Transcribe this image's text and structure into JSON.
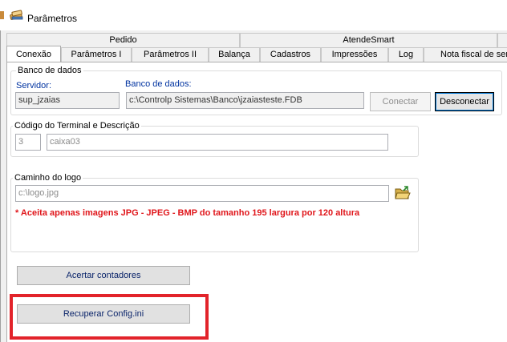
{
  "window": {
    "title": "Parâmetros"
  },
  "tabs_top": [
    {
      "label": "Pedido"
    },
    {
      "label": "AtendeSmart"
    }
  ],
  "tabs_bottom": [
    {
      "label": "Conexão",
      "active": true
    },
    {
      "label": "Parâmetros I"
    },
    {
      "label": "Parâmetros II"
    },
    {
      "label": "Balança"
    },
    {
      "label": "Cadastros"
    },
    {
      "label": "Impressões"
    },
    {
      "label": "Log"
    },
    {
      "label": "Nota fiscal de ser"
    }
  ],
  "database_group": {
    "title": "Banco de dados",
    "server_label": "Servidor:",
    "server_value": "sup_jzaias",
    "db_label": "Banco de dados:",
    "db_value": "c:\\Controlp Sistemas\\Banco\\jzaiasteste.FDB",
    "connect_button": "Conectar",
    "disconnect_button": "Desconectar"
  },
  "terminal_group": {
    "title": "Código do Terminal e Descrição",
    "code_value": "3",
    "description_value": "caixa03"
  },
  "logo_group": {
    "title": "Caminho do logo",
    "path_value": "c:\\logo.jpg",
    "warning": "* Aceita apenas imagens JPG - JPEG - BMP do tamanho 195 largura por 120 altura",
    "folder_icon": "open-folder-icon"
  },
  "actions": {
    "adjust_counters": "Acertar contadores",
    "recover_config": "Recuperar Config.ini"
  },
  "colors": {
    "highlight": "#e2232a",
    "warning": "#e0161b",
    "label_blue": "#0033a0"
  }
}
